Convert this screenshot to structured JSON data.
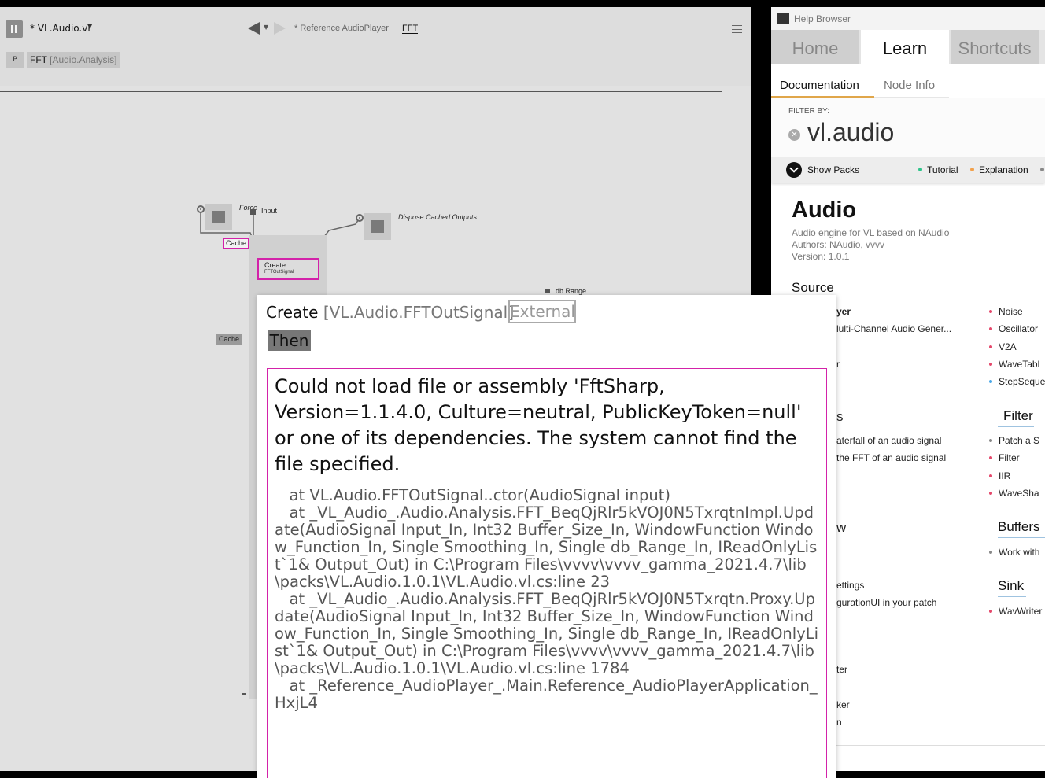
{
  "editor": {
    "document_title": "* VL.Audio.vl",
    "breadcrumb": "* Reference AudioPlayer",
    "breadcrumb_active": "FFT",
    "patch_badge": "P",
    "definition_name": "FFT",
    "definition_category": "[Audio.Analysis]",
    "labels": {
      "force": "Force",
      "input": "Input",
      "dispose": "Dispose Cached Outputs",
      "cache": "Cache",
      "cache2": "Cache",
      "create_line1": "Create",
      "create_line2": "FFTOutSignal",
      "db_range": "db Range"
    }
  },
  "help": {
    "window_title": "Help Browser",
    "tabs": [
      "Home",
      "Learn",
      "Shortcuts"
    ],
    "subtabs": [
      "Documentation",
      "Node Info"
    ],
    "filter_label": "FILTER BY:",
    "filter_value": "vl.audio",
    "show_packs": "Show Packs",
    "legend": [
      "Tutorial",
      "Explanation"
    ],
    "pack": {
      "title": "Audio",
      "description": "Audio engine for VL based on NAudio",
      "authors": "Authors: NAudio,  vvvv",
      "version": "Version: 1.0.1"
    },
    "source_heading": "Source",
    "left_fragments": [
      "yer",
      "lulti-Channel Audio Gener...",
      "r",
      "s",
      "aterfall of an audio signal",
      " the FFT of an audio signal",
      "w",
      "ettings",
      "gurationUI in your patch",
      "ter",
      "ker",
      "n"
    ],
    "source_items": [
      "Noise",
      "Oscillator",
      "V2A",
      "WaveTabl",
      "StepSeque"
    ],
    "filter_heading": "Filter",
    "filter_items": [
      "Patch a S",
      "Filter",
      "IIR",
      "WaveSha"
    ],
    "buffers_heading": "Buffers",
    "buffers_items": [
      "Work with"
    ],
    "sink_heading": "Sink",
    "sink_items": [
      "WavWriter"
    ],
    "colors": {
      "tutorial": "#2ec48a",
      "explanation": "#f2a14b",
      "reference": "#e5486b",
      "gray": "#888888",
      "blue": "#4aa8e8"
    }
  },
  "tooltip": {
    "node_name": "Create",
    "node_category": "[VL.Audio.FFTOutSignal]",
    "external_badge": "External",
    "then_badge": "Then",
    "error_message": "Could not load file or assembly 'FftSharp, Version=1.1.4.0, Culture=neutral, PublicKeyToken=null' or one of its dependencies. The system cannot find the file specified.",
    "stack_trace": "   at VL.Audio.FFTOutSignal..ctor(AudioSignal input)\n   at _VL_Audio_.Audio.Analysis.FFT_BeqQjRlr5kVOJ0N5TxrqtnImpl.Update(AudioSignal Input_In, Int32 Buffer_Size_In, WindowFunction Window_Function_In, Single Smoothing_In, Single db_Range_In, IReadOnlyList`1& Output_Out) in C:\\Program Files\\vvvv\\vvvv_gamma_2021.4.7\\lib\\packs\\VL.Audio.1.0.1\\VL.Audio.vl.cs:line 23\n   at _VL_Audio_.Audio.Analysis.FFT_BeqQjRlr5kVOJ0N5Txrqtn.Proxy.Update(AudioSignal Input_In, Int32 Buffer_Size_In, WindowFunction Window_Function_In, Single Smoothing_In, Single db_Range_In, IReadOnlyList`1& Output_Out) in C:\\Program Files\\vvvv\\vvvv_gamma_2021.4.7\\lib\\packs\\VL.Audio.1.0.1\\VL.Audio.vl.cs:line 1784\n   at _Reference_AudioPlayer_.Main.Reference_AudioPlayerApplication_HxjL4"
  }
}
